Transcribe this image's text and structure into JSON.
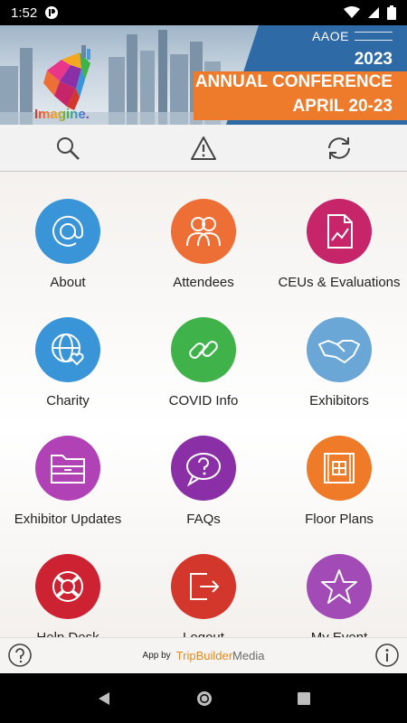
{
  "status_bar": {
    "time": "1:52"
  },
  "banner": {
    "org": "AAOE",
    "year": "2023",
    "title": "ANNUAL CONFERENCE",
    "dates": "APRIL 20-23",
    "logo_text": "Imagine.",
    "colors": {
      "panel": "#2d6aa6",
      "accent": "#ee7a2b"
    }
  },
  "toolbar": {
    "items": [
      {
        "icon": "search-icon"
      },
      {
        "icon": "warning-icon"
      },
      {
        "icon": "refresh-icon"
      }
    ]
  },
  "tiles": [
    {
      "label": "About",
      "icon": "at-sign-icon",
      "color": "#3a95d8"
    },
    {
      "label": "Attendees",
      "icon": "people-icon",
      "color": "#ee6f35"
    },
    {
      "label": "CEUs & Evaluations",
      "icon": "report-icon",
      "color": "#c7256a"
    },
    {
      "label": "Charity",
      "icon": "globe-heart-icon",
      "color": "#3a95d8"
    },
    {
      "label": "COVID Info",
      "icon": "link-icon",
      "color": "#3fb24a"
    },
    {
      "label": "Exhibitors",
      "icon": "handshake-icon",
      "color": "#6aa6d6"
    },
    {
      "label": "Exhibitor Updates",
      "icon": "folder-icon",
      "color": "#b142b6"
    },
    {
      "label": "FAQs",
      "icon": "question-bubble-icon",
      "color": "#8a2fa6"
    },
    {
      "label": "Floor Plans",
      "icon": "floor-plan-icon",
      "color": "#ef7a27"
    },
    {
      "label": "Help Desk",
      "icon": "lifebuoy-icon",
      "color": "#cc2232"
    },
    {
      "label": "Logout",
      "icon": "logout-icon",
      "color": "#d3362a"
    },
    {
      "label": "My Event",
      "icon": "star-icon",
      "color": "#a24bb7"
    }
  ],
  "footer": {
    "app_by": "App by",
    "brand_1": "TripBuilder",
    "brand_2": "Media"
  }
}
